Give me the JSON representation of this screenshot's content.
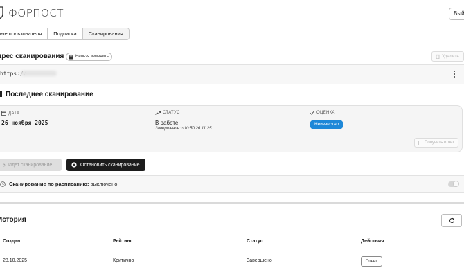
{
  "header": {
    "logo_text": "ФОРПОСТ",
    "logout_label": "Выйти"
  },
  "tabs": [
    {
      "label": "ные пользователя"
    },
    {
      "label": "Подписка"
    },
    {
      "label": "Сканирования",
      "active": true
    }
  ],
  "address": {
    "title": "дрес сканирования",
    "lock_label": "Нельзя изменить",
    "delete_label": "Удалить",
    "url_prefix": "https://"
  },
  "last_scan": {
    "title": "Последнее сканирование",
    "date_label": "ДАТА",
    "date_value": "26 ноября 2025",
    "status_label": "СТАТУС",
    "status_value": "В работе",
    "finish_value": "Завершение: ~10:50 26.11.25",
    "rating_label": "ОЦЕНКА",
    "rating_value": "Неизвестно",
    "get_report_label": "Получить отчет"
  },
  "actions": {
    "running_label": "Идет сканирование...",
    "stop_label": "Остановить сканирование"
  },
  "schedule": {
    "label": "Сканирование по расписанию:",
    "value": "выключено",
    "enabled": false
  },
  "history": {
    "title": "История",
    "columns": [
      "Создан",
      "Рейтинг",
      "Статус",
      "Действия"
    ],
    "rows": [
      {
        "created": "28.10.2025",
        "rating": "Критично",
        "status": "Завершено",
        "action_label": "Отчет"
      }
    ]
  },
  "colors": {
    "accent": "#1e88d8",
    "dark_button": "#1c1c1c",
    "card_bg": "#f5f5f5"
  }
}
